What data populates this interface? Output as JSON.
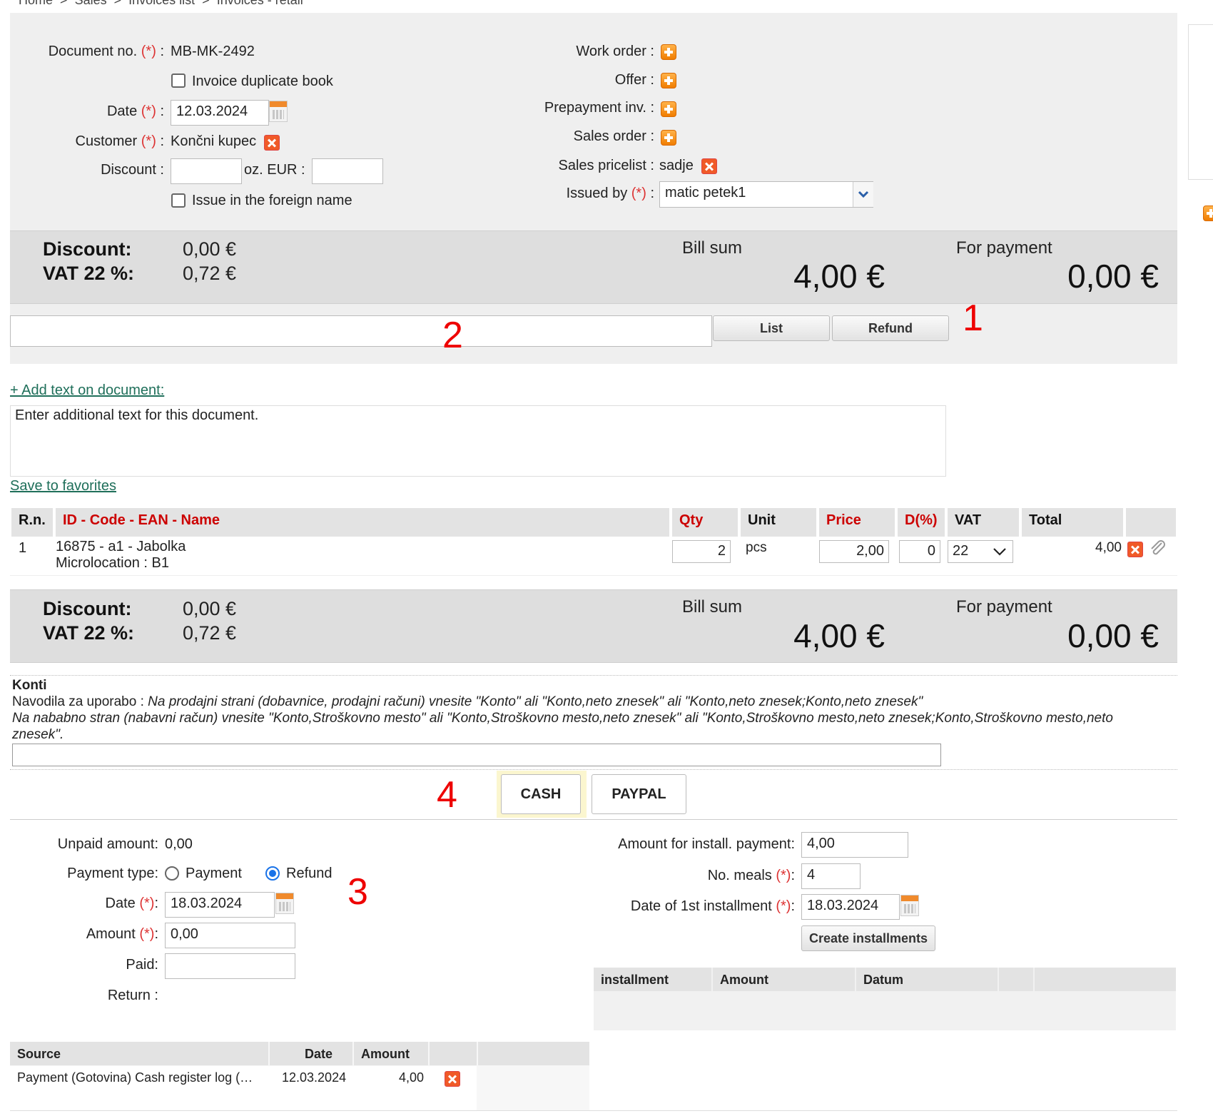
{
  "breadcrumb": [
    "Home",
    ">",
    "Sales",
    ">",
    "Invoices list",
    ">",
    "Invoices - retail"
  ],
  "header": {
    "document_no_label": "Document no.",
    "required_marker": "(*)",
    "colon": ":",
    "document_no": "MB-MK-2492",
    "duplicate_book_label": "Invoice duplicate book",
    "date_label": "Date",
    "date_value": "12.03.2024",
    "customer_label": "Customer",
    "customer_value": "Končni kupec",
    "discount_label": "Discount :",
    "oz_eur_label": "oz. EUR :",
    "foreign_name_label": "Issue in the foreign name",
    "work_order_label": "Work order :",
    "offer_label": "Offer :",
    "prepayment_label": "Prepayment inv. :",
    "sales_order_label": "Sales order :",
    "pricelist_label": "Sales pricelist :",
    "pricelist_value": "sadje",
    "issued_by_label": "Issued by",
    "issued_by_value": "matic petek1"
  },
  "summary": {
    "discount_label": "Discount:",
    "discount_value": "0,00 €",
    "vat_label": "VAT 22 %:",
    "vat_value": "0,72 €",
    "bill_sum_label": "Bill sum",
    "bill_sum_value": "4,00 €",
    "for_payment_label": "For payment",
    "for_payment_value": "0,00 €"
  },
  "search_bar": {
    "list_button": "List",
    "refund_button": "Refund"
  },
  "annotations": {
    "a1": "1",
    "a2": "2",
    "a3": "3",
    "a4": "4"
  },
  "text_section": {
    "add_text_link": "+ Add text on document:",
    "textarea_placeholder": "Enter additional text for this document.",
    "save_favorites_link": "Save to favorites"
  },
  "items_table": {
    "headers": {
      "rn": "R.n.",
      "name": "ID - Code - EAN - Name",
      "qty": "Qty",
      "unit": "Unit",
      "price": "Price",
      "discount": "D(%)",
      "vat": "VAT",
      "total": "Total"
    },
    "rows": [
      {
        "rn": "1",
        "name": "16875 - a1 - Jabolka",
        "microlocation": "Microlocation : B1",
        "qty": "2",
        "unit": "pcs",
        "price": "2,00",
        "discount": "0",
        "vat": "22",
        "total": "4,00"
      }
    ]
  },
  "konti": {
    "title": "Konti",
    "line1_prefix": "Navodila za uporabo : ",
    "line1_italic": "Na prodajni strani (dobavnice, prodajni računi) vnesite \"Konto\" ali \"Konto,neto znesek\" ali \"Konto,neto znesek;Konto,neto znesek\"",
    "line2": "Na nababno stran (nabavni račun) vnesite \"Konto,Stroškovno mesto\" ali \"Konto,Stroškovno mesto,neto znesek\" ali \"Konto,Stroškovno mesto,neto znesek;Konto,Stroškovno mesto,neto",
    "line3": "znesek\"."
  },
  "payment_buttons": {
    "cash": "CASH",
    "paypal": "PAYPAL"
  },
  "payment": {
    "unpaid_label": "Unpaid amount:",
    "unpaid_value": "0,00",
    "payment_type_label": "Payment type:",
    "option_payment": "Payment",
    "option_refund": "Refund",
    "date_label": "Date",
    "date_value": "18.03.2024",
    "amount_label": "Amount",
    "amount_value": "0,00",
    "paid_label": "Paid:",
    "return_label": "Return :"
  },
  "installments": {
    "amount_label": "Amount for install. payment:",
    "amount_value": "4,00",
    "meals_label": "No. meals",
    "meals_value": "4",
    "first_date_label": "Date of 1st installment",
    "first_date_value": "18.03.2024",
    "create_button": "Create installments",
    "headers": {
      "installment": "installment",
      "amount": "Amount",
      "datum": "Datum"
    }
  },
  "payments_log": {
    "headers": {
      "source": "Source",
      "date": "Date",
      "amount": "Amount"
    },
    "rows": [
      {
        "source": "Payment (Gotovina) Cash register log (…",
        "date": "12.03.2024",
        "amount": "4,00"
      }
    ]
  },
  "colors": {
    "accent_red": "#d33",
    "link_green": "#1f6f5a",
    "panel_grey": "#efefef",
    "summary_grey": "#dedede"
  }
}
